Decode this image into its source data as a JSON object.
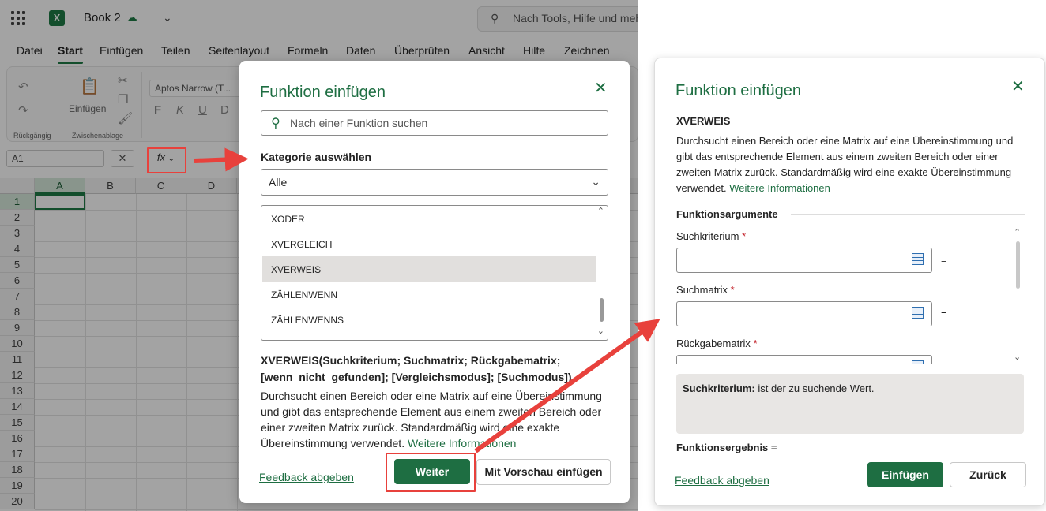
{
  "excel": {
    "book_name": "Book 2",
    "search_placeholder": "Nach Tools, Hilfe und meh",
    "menu": [
      "Datei",
      "Start",
      "Einfügen",
      "Teilen",
      "Seitenlayout",
      "Formeln",
      "Daten",
      "Überprüfen",
      "Ansicht",
      "Hilfe",
      "Zeichnen"
    ],
    "active_menu": "Start",
    "ribbon": {
      "undo_group": "Rückgängig",
      "clipboard_group": "Zwischenablage",
      "paste_label": "Einfügen",
      "font_name": "Aptos Narrow (T...",
      "format_buttons": [
        "F",
        "K",
        "U",
        "D"
      ]
    },
    "name_box": "A1",
    "fx_label": "fx",
    "columns": [
      "A",
      "B",
      "C",
      "D"
    ],
    "rows": [
      "1",
      "2",
      "3",
      "4",
      "5",
      "6",
      "7",
      "8",
      "9",
      "10",
      "11",
      "12",
      "13",
      "14",
      "15",
      "16",
      "17",
      "18",
      "19",
      "20"
    ]
  },
  "dialog1": {
    "title": "Funktion einfügen",
    "search_placeholder": "Nach einer Funktion suchen",
    "category_label": "Kategorie auswählen",
    "category_value": "Alle",
    "functions": [
      "XODER",
      "XVERGLEICH",
      "XVERWEIS",
      "ZÄHLENWENN",
      "ZÄHLENWENNS"
    ],
    "selected_function": "XVERWEIS",
    "syntax": "XVERWEIS(Suchkriterium; Suchmatrix; Rückgabematrix; [wenn_nicht_gefunden]; [Vergleichsmodus]; [Suchmodus])",
    "description": "Durchsucht einen Bereich oder eine Matrix auf eine Übereinstimmung und gibt das entsprechende Element aus einem zweiten Bereich oder einer zweiten Matrix zurück. Standardmäßig wird eine exakte Übereinstimmung verwendet.",
    "more_info": "Weitere Informationen",
    "feedback": "Feedback abgeben",
    "next_button": "Weiter",
    "preview_button": "Mit Vorschau einfügen"
  },
  "dialog2": {
    "title": "Funktion einfügen",
    "function_name": "XVERWEIS",
    "description": "Durchsucht einen Bereich oder eine Matrix auf eine Übereinstimmung und gibt das entsprechende Element aus einem zweiten Bereich oder einer zweiten Matrix zurück. Standardmäßig wird eine exakte Übereinstimmung verwendet.",
    "more_info": "Weitere Informationen",
    "args_header": "Funktionsargumente",
    "args": [
      {
        "label": "Suchkriterium",
        "value": "",
        "equals": "="
      },
      {
        "label": "Suchmatrix",
        "value": "",
        "equals": "="
      },
      {
        "label": "Rückgabematrix",
        "value": ""
      }
    ],
    "required_marker": "*",
    "info_term": "Suchkriterium:",
    "info_text": "ist der zu suchende Wert.",
    "result_label": "Funktionsergebnis =",
    "feedback": "Feedback abgeben",
    "insert_button": "Einfügen",
    "back_button": "Zurück"
  },
  "colors": {
    "accent": "#1e6e42",
    "annotation_red": "#e8413c"
  }
}
